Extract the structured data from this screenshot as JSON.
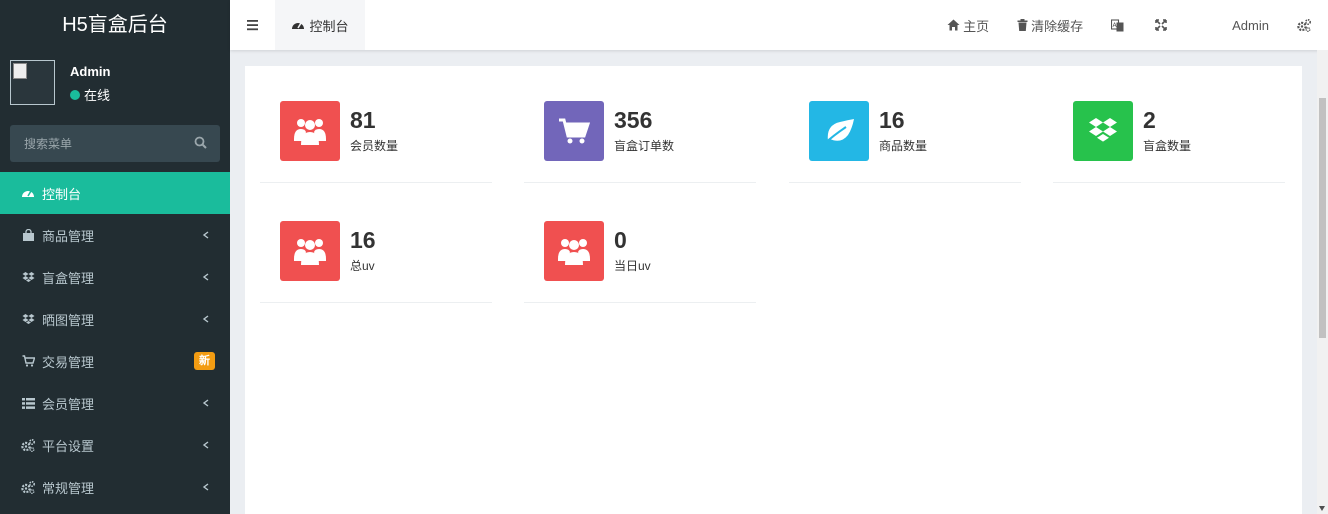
{
  "sidebar": {
    "brand": "H5盲盒后台",
    "user": {
      "name": "Admin",
      "status": "在线"
    },
    "search_placeholder": "搜索菜单",
    "items": [
      {
        "label": "控制台",
        "icon": "dashboard-icon",
        "active": true
      },
      {
        "label": "商品管理",
        "icon": "shopping-bag-icon",
        "has_arrow": true
      },
      {
        "label": "盲盒管理",
        "icon": "dropbox-icon",
        "has_arrow": true
      },
      {
        "label": "晒图管理",
        "icon": "dropbox-icon",
        "has_arrow": true
      },
      {
        "label": "交易管理",
        "icon": "cart-icon",
        "badge": "新"
      },
      {
        "label": "会员管理",
        "icon": "list-icon",
        "has_arrow": true
      },
      {
        "label": "平台设置",
        "icon": "cogs-icon",
        "has_arrow": true
      },
      {
        "label": "常规管理",
        "icon": "cogs-icon",
        "has_arrow": true
      }
    ]
  },
  "header": {
    "tab_label": "控制台",
    "home_label": "主页",
    "clear_cache_label": "清除缓存",
    "user_label": "Admin"
  },
  "stats": [
    {
      "value": "81",
      "label": "会员数量",
      "icon": "users-icon",
      "color": "#f05050"
    },
    {
      "value": "356",
      "label": "盲盒订单数",
      "icon": "cart-icon",
      "color": "#7266ba"
    },
    {
      "value": "16",
      "label": "商品数量",
      "icon": "leaf-icon",
      "color": "#23b7e5"
    },
    {
      "value": "2",
      "label": "盲盒数量",
      "icon": "dropbox-icon",
      "color": "#27c24c"
    },
    {
      "value": "16",
      "label": "总uv",
      "icon": "users-icon",
      "color": "#f05050"
    },
    {
      "value": "0",
      "label": "当日uv",
      "icon": "users-icon",
      "color": "#f05050"
    }
  ],
  "colors": {
    "sidebar_bg": "#222d32",
    "active": "#1abc9c",
    "badge": "#f39c12"
  }
}
